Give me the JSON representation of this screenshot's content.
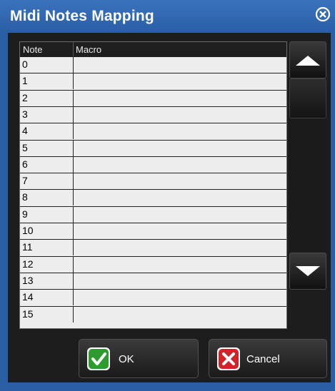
{
  "window": {
    "title": "Midi Notes Mapping"
  },
  "table": {
    "columns": [
      "Note",
      "Macro"
    ],
    "rows": [
      {
        "note": "0",
        "macro": ""
      },
      {
        "note": "1",
        "macro": ""
      },
      {
        "note": "2",
        "macro": ""
      },
      {
        "note": "3",
        "macro": ""
      },
      {
        "note": "4",
        "macro": ""
      },
      {
        "note": "5",
        "macro": ""
      },
      {
        "note": "6",
        "macro": ""
      },
      {
        "note": "7",
        "macro": ""
      },
      {
        "note": "8",
        "macro": ""
      },
      {
        "note": "9",
        "macro": ""
      },
      {
        "note": "10",
        "macro": ""
      },
      {
        "note": "11",
        "macro": ""
      },
      {
        "note": "12",
        "macro": ""
      },
      {
        "note": "13",
        "macro": ""
      },
      {
        "note": "14",
        "macro": ""
      },
      {
        "note": "15",
        "macro": ""
      }
    ]
  },
  "buttons": {
    "ok_label": "OK",
    "cancel_label": "Cancel"
  },
  "icons": {
    "close": "close-circle-icon",
    "scroll_up": "arrow-up-icon",
    "scroll_down": "arrow-down-icon",
    "ok": "check-icon",
    "cancel": "x-icon"
  },
  "colors": {
    "title_bar": "#2a5fa6",
    "panel": "#1d1d1d",
    "table_bg": "#ededed",
    "ok_green": "#2e9b2e",
    "cancel_red": "#d1242a"
  }
}
